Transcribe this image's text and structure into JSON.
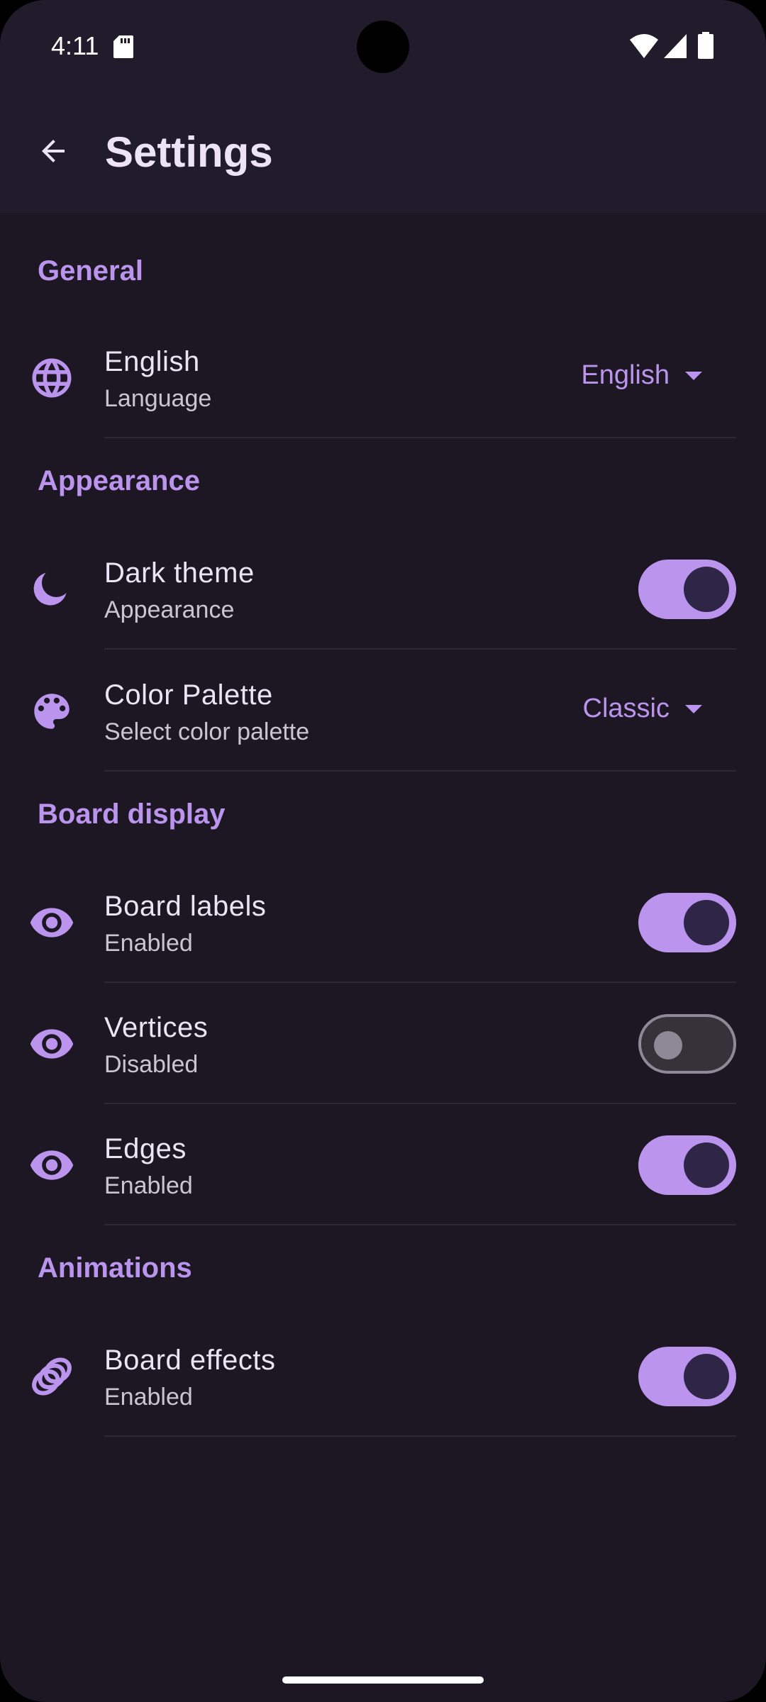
{
  "status_bar": {
    "time": "4:11"
  },
  "app_bar": {
    "title": "Settings"
  },
  "sections": {
    "general": {
      "header": "General",
      "language": {
        "title": "English",
        "subtitle": "Language",
        "value": "English"
      }
    },
    "appearance": {
      "header": "Appearance",
      "dark_theme": {
        "title": "Dark theme",
        "subtitle": "Appearance",
        "enabled": true
      },
      "color_palette": {
        "title": "Color Palette",
        "subtitle": "Select color palette",
        "value": "Classic"
      }
    },
    "board_display": {
      "header": "Board display",
      "board_labels": {
        "title": "Board labels",
        "subtitle": "Enabled",
        "enabled": true
      },
      "vertices": {
        "title": "Vertices",
        "subtitle": "Disabled",
        "enabled": false
      },
      "edges": {
        "title": "Edges",
        "subtitle": "Enabled",
        "enabled": true
      }
    },
    "animations": {
      "header": "Animations",
      "board_effects": {
        "title": "Board effects",
        "subtitle": "Enabled",
        "enabled": true
      }
    }
  },
  "colors": {
    "accent": "#bb94ee",
    "background": "#1c1723",
    "appbar": "#211c2b",
    "text_primary": "#ece3f4",
    "text_secondary": "#cbc4d3"
  },
  "icons": [
    "arrow-back-icon",
    "globe-icon",
    "moon-icon",
    "palette-icon",
    "eye-icon",
    "rings-icon"
  ]
}
